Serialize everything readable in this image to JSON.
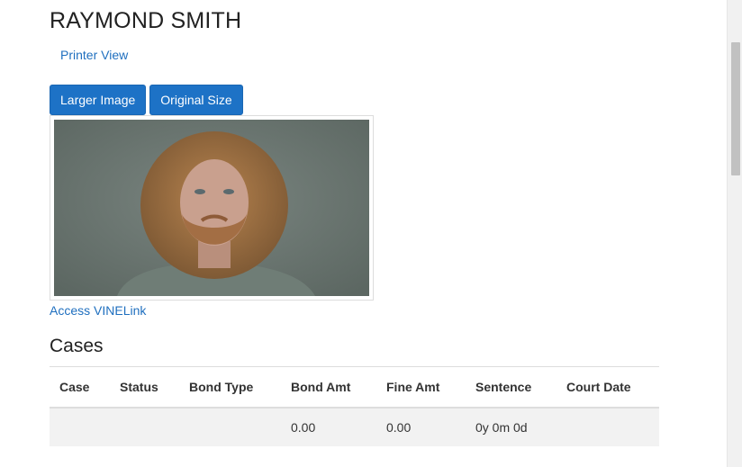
{
  "person": {
    "name": "RAYMOND SMITH"
  },
  "links": {
    "printer_view": "Printer View",
    "vinelink": "Access VINELink"
  },
  "buttons": {
    "larger_image": "Larger Image",
    "original_size": "Original Size"
  },
  "cases": {
    "title": "Cases",
    "headers": [
      "Case",
      "Status",
      "Bond Type",
      "Bond Amt",
      "Fine Amt",
      "Sentence",
      "Court Date"
    ],
    "rows": [
      [
        "",
        "",
        "",
        "0.00",
        "0.00",
        "0y 0m 0d",
        ""
      ]
    ]
  },
  "colors": {
    "primary_button": "#1d72c6",
    "link": "#1f6fbf",
    "row_background": "#f2f2f2"
  }
}
